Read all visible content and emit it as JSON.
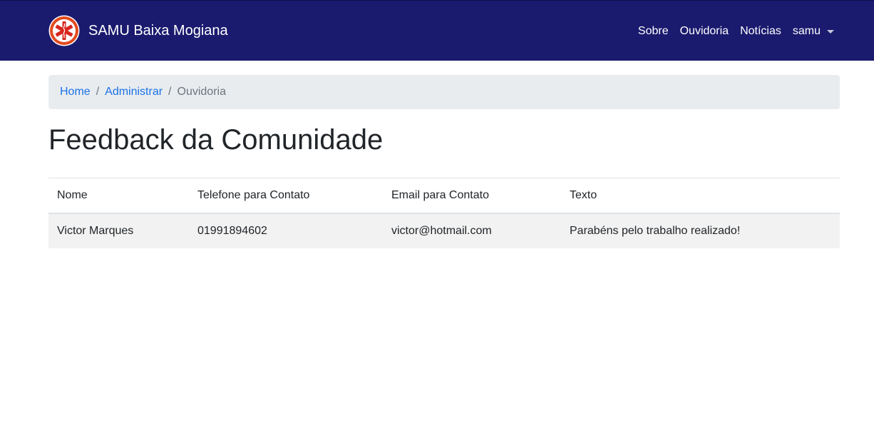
{
  "navbar": {
    "brand": "SAMU Baixa Mogiana",
    "logo_icon": "star-of-life-icon",
    "links": [
      "Sobre",
      "Ouvidoria",
      "Notícias"
    ],
    "user_menu": "samu",
    "background_color": "#1a1a6f"
  },
  "breadcrumb": {
    "items": [
      "Home",
      "Administrar"
    ],
    "active": "Ouvidoria"
  },
  "page": {
    "title": "Feedback da Comunidade"
  },
  "table": {
    "headers": [
      "Nome",
      "Telefone para Contato",
      "Email para Contato",
      "Texto"
    ],
    "rows": [
      [
        "Victor Marques",
        "01991894602",
        "victor@hotmail.com",
        "Parabéns pelo trabalho realizado!"
      ]
    ]
  }
}
